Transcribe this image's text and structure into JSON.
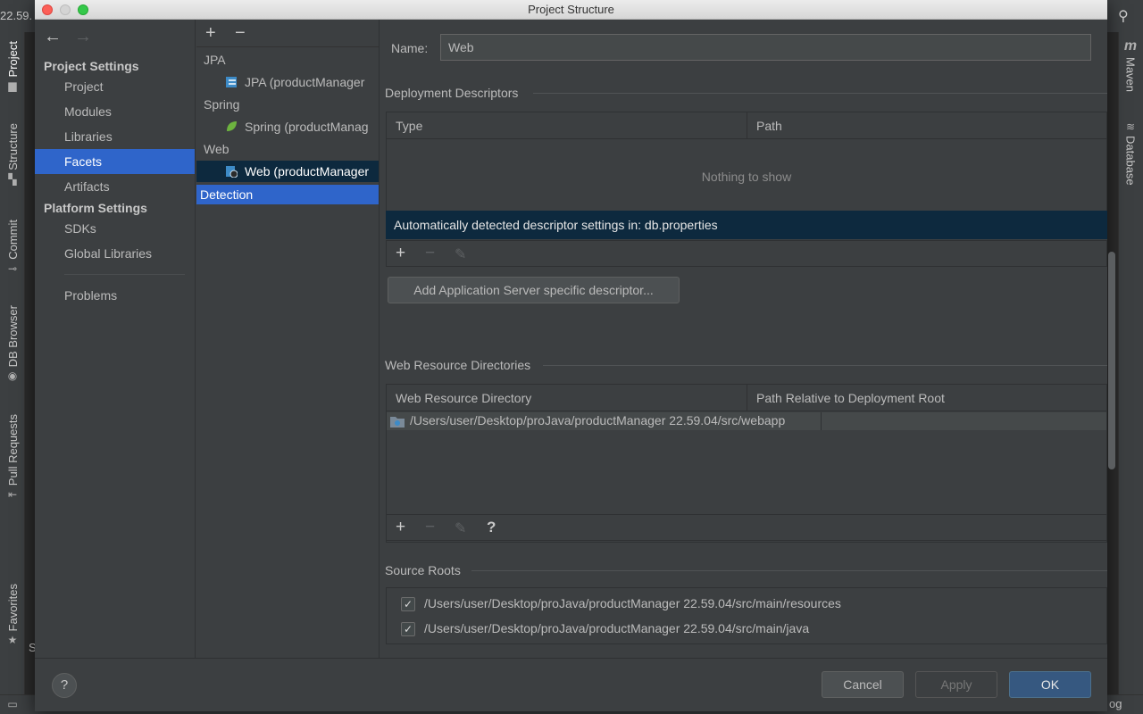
{
  "ide": {
    "top_left_text": "22.59.",
    "left_tabs": [
      "Project",
      "Structure",
      "Commit",
      "DB Browser",
      "Pull Requests",
      "Favorites"
    ],
    "right_tabs": [
      "Maven",
      "Database"
    ],
    "right_tab_maven_glyph": "m",
    "bottom_left_text": "S",
    "bottom_right_text": "og"
  },
  "dialog": {
    "title": "Project Structure",
    "nav": {
      "back": "←",
      "forward": "→",
      "project_settings_heading": "Project Settings",
      "project_settings_items": [
        "Project",
        "Modules",
        "Libraries",
        "Facets",
        "Artifacts"
      ],
      "selected": "Facets",
      "platform_settings_heading": "Platform Settings",
      "platform_settings_items": [
        "SDKs",
        "Global Libraries"
      ],
      "problems": "Problems"
    },
    "tree": {
      "add": "+",
      "remove": "−",
      "groups": [
        {
          "label": "JPA",
          "item": "JPA (productManager"
        },
        {
          "label": "Spring",
          "item": "Spring (productManag"
        },
        {
          "label": "Web",
          "item": "Web (productManager"
        }
      ],
      "detection": "Detection"
    },
    "content": {
      "name_label": "Name:",
      "name_value": "Web",
      "deployment": {
        "title": "Deployment Descriptors",
        "columns": [
          "Type",
          "Path"
        ],
        "empty": "Nothing to show",
        "detected": "Automatically detected descriptor settings in: db.properties",
        "toolbar": [
          "+",
          "−",
          "✎"
        ],
        "add_server_button": "Add Application Server specific descriptor..."
      },
      "web_resources": {
        "title": "Web Resource Directories",
        "columns": [
          "Web Resource Directory",
          "Path Relative to Deployment Root"
        ],
        "rows": [
          {
            "directory": "/Users/user/Desktop/proJava/productManager 22.59.04/src/webapp",
            "path": ""
          }
        ],
        "toolbar": [
          "+",
          "−",
          "✎",
          "?"
        ]
      },
      "source_roots": {
        "title": "Source Roots",
        "items": [
          {
            "checked": true,
            "path": "/Users/user/Desktop/proJava/productManager 22.59.04/src/main/resources"
          },
          {
            "checked": true,
            "path": "/Users/user/Desktop/proJava/productManager 22.59.04/src/main/java"
          }
        ]
      }
    },
    "buttons": {
      "help": "?",
      "cancel": "Cancel",
      "apply": "Apply",
      "ok": "OK"
    },
    "check_mark": "✓",
    "colors": {
      "selection": "#2f65ca",
      "inactive_selection": "#0d293e",
      "primary_button": "#365880"
    }
  }
}
